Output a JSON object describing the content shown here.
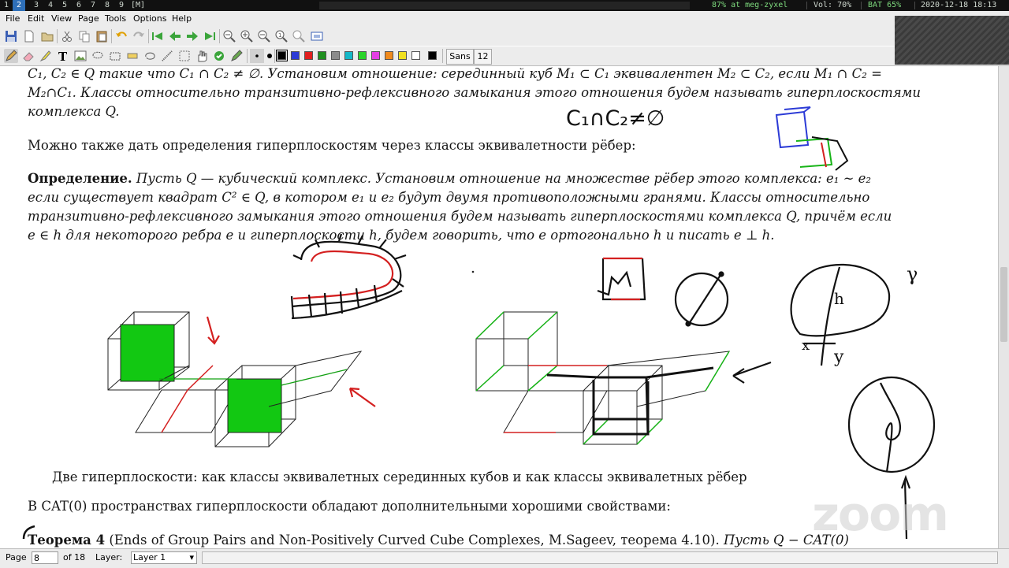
{
  "statusbar": {
    "workspaces": [
      "1",
      "2",
      "3",
      "4",
      "5",
      "6",
      "7",
      "8",
      "9"
    ],
    "active_workspace": "2",
    "layout": "[M]",
    "load": "87% at meg-zyxel",
    "volume": "Vol: 70%",
    "battery": "BAT 65%",
    "datetime": "2020-12-18 18:13"
  },
  "menubar": {
    "items": [
      "File",
      "Edit",
      "View",
      "Page",
      "Tools",
      "Options",
      "Help"
    ]
  },
  "toolbar": {
    "colors": [
      "#000000",
      "#2c3bd6",
      "#e21f1f",
      "#1f8f1f",
      "#8c8c8c",
      "#15b8c8",
      "#2ad42a",
      "#e43ee4",
      "#f08a1c",
      "#f0e020",
      "#ffffff"
    ],
    "font_name": "Sans",
    "font_size": "12"
  },
  "document": {
    "top_line1": "C₁, C₂ ∈ Q такие что C₁ ∩ C₂ ≠ ∅. Установим отношение: серединный куб M₁ ⊂ C₁ эквивалентен M₂ ⊂ C₂, если M₁ ∩ C₂ =",
    "top_line2": "M₂∩C₁. Классы относительно транзитивно-рефлексивного замыкания этого отношения будем называть гиперплоскостями",
    "top_line3": "комплекса Q.",
    "para2": "Можно также дать определения гиперплоскостям через классы эквивалетности рёбер:",
    "def_label": "Определение.",
    "def_line1": "Пусть Q — кубический комплекс. Установим отношение на множестве рёбер этого комплекса: e₁ ∼ e₂",
    "def_line2": "если существует квадрат C² ∈ Q, в котором e₁ и e₂ будут двумя противоположными гранями. Классы относительно",
    "def_line3": "транзитивно-рефлексивного замыкания этого отношения будем называть гиперплоскостями комплекса Q, причём если",
    "def_line4": "e ∈ h для некоторого ребра e и гиперплоскости h, будем говорить, что e ортогонально h и писать e ⊥ h.",
    "caption": "Две гиперплоскости: как классы эквивалетных серединных кубов и как классы эквивалетных рёбер",
    "para3": "В CAT(0) пространствах гиперплоскости обладают дополнительными хорошими свойствами:",
    "theorem_label": "Теорема 4",
    "theorem_text": "(Ends of Group Pairs and Non-Positively Curved Cube Complexes, M.Sageev, теорема 4.10).",
    "theorem_tail": "Пусть Q − CAT(0)"
  },
  "annotations": {
    "handwritten_formula": "C₁∩C₂≠∅",
    "label_h": "h",
    "label_gamma": "γ",
    "label_x": "x",
    "label_y": "y"
  },
  "watermark": "zoom",
  "bottombar": {
    "page_label": "Page",
    "page_value": "8",
    "of_label": "of 18",
    "layer_label": "Layer:",
    "layer_value": "Layer 1"
  }
}
